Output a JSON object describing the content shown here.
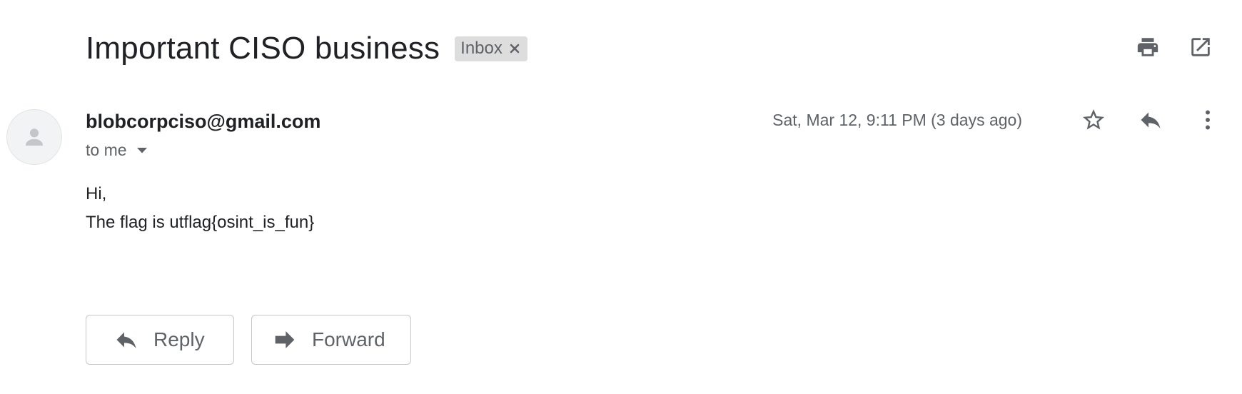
{
  "email": {
    "subject": "Important CISO business",
    "label": "Inbox",
    "sender": "blobcorpciso@gmail.com",
    "recipients": "to me",
    "date": "Sat, Mar 12, 9:11 PM (3 days ago)",
    "body_lines": [
      "Hi,",
      "The flag is utflag{osint_is_fun}"
    ]
  },
  "actions": {
    "reply_label": "Reply",
    "forward_label": "Forward"
  },
  "icons": {
    "print": "print-icon",
    "open_new_window": "open-in-new-window-icon",
    "star": "star-outline-icon",
    "reply": "reply-icon",
    "more": "more-vertical-icon",
    "forward": "forward-icon",
    "avatar": "person-icon",
    "label_close": "close-icon",
    "recipients_toggle": "caret-down-icon"
  },
  "colors": {
    "icon_grey": "#5f6368",
    "text_dark": "#202124",
    "chip_bg": "#dddddd"
  }
}
